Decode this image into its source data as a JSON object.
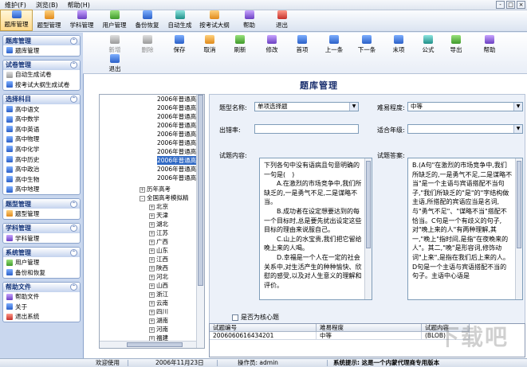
{
  "menubar": {
    "items": [
      "维护(F)",
      "浏览(B)",
      "帮助(H)"
    ]
  },
  "window_controls": [
    "-",
    "□",
    "×"
  ],
  "toolbar": {
    "items": [
      {
        "label": "题库管理",
        "icon": "database-icon"
      },
      {
        "label": "题型管理",
        "icon": "list-icon"
      },
      {
        "label": "学科管理",
        "icon": "book-icon"
      },
      {
        "label": "用户管理",
        "icon": "users-icon"
      },
      {
        "label": "备份恢复",
        "icon": "save-icon"
      },
      {
        "label": "自动生成",
        "icon": "generate-icon"
      },
      {
        "label": "按考试大纲",
        "icon": "outline-icon"
      },
      {
        "label": "帮助",
        "icon": "help-icon"
      },
      {
        "label": "退出",
        "icon": "exit-icon"
      }
    ]
  },
  "sidebar": {
    "panels": [
      {
        "title": "题库管理",
        "items": [
          "题库管理"
        ]
      },
      {
        "title": "试卷管理",
        "items": [
          "自动生成试卷",
          "按考试大纲生成试卷"
        ]
      },
      {
        "title": "选择科目",
        "items": [
          "高中语文",
          "高中数学",
          "高中英语",
          "高中物理",
          "高中化学",
          "高中历史",
          "高中政治",
          "高中生物",
          "高中地理"
        ]
      },
      {
        "title": "题型管理",
        "items": [
          "题型管理"
        ]
      },
      {
        "title": "学科管理",
        "items": [
          "学科管理"
        ]
      },
      {
        "title": "系统管理",
        "items": [
          "用户管理",
          "备份和恢复"
        ]
      },
      {
        "title": "帮助文件",
        "items": [
          "帮助文件",
          "关于",
          "退出系统"
        ]
      }
    ]
  },
  "subtoolbar": {
    "items": [
      "新增",
      "删除",
      "保存",
      "取消",
      "刷新",
      "修改",
      "首项",
      "上一条",
      "下一条",
      "末项",
      "公式",
      "导出",
      "帮助",
      "退出"
    ]
  },
  "page_title": "题库管理",
  "tree": {
    "items": [
      "2006年普通高",
      "2006年普通高",
      "2006年普通高",
      "2006年普通高",
      "2006年普通高",
      "2006年普通高",
      "2006年普通高",
      "2006年普通高",
      "2006年普通高",
      "2006年普通高"
    ],
    "selected_index": 7,
    "groups": [
      "历年高考",
      "全国高考模拟精"
    ],
    "regions": [
      "北京",
      "天津",
      "湖北",
      "江苏",
      "广西",
      "山东",
      "江西",
      "陕西",
      "河北",
      "山西",
      "浙江",
      "云南",
      "四川",
      "湖南",
      "河南",
      "福建",
      "广东",
      "上海"
    ]
  },
  "form": {
    "type_label": "题型名称:",
    "type_value": "单项选择题",
    "difficulty_label": "难易程度:",
    "difficulty_value": "中等",
    "setter_label": "出错率:",
    "setter_value": "",
    "grade_label": "适合年级:",
    "grade_value": "",
    "content_label": "试题内容:",
    "answer_label": "试题答案:",
    "content_text": "下列各句中没有语病且句意明确的一句是(　)\n　　A.在激烈的市场竞争中,我们所缺乏的,一是勇气不足,二是谋略不当。\n　　B.成功者在设定想要达到的每一个目标时,总是要先扰出设定这些目标的理由来说服自己。\n　　C.山上的水宝贵,我们把它留给晚上来的人喝。\n　　D.幸福是一个人在一定的社会关系中,对生活产生的种种愉快、欣慰的感受,以及对人生意义的理解和评价。",
    "answer_text": "B.(A句\"在激烈的市场竞争中,我们所缺乏的,一是勇气不足,二是谋略不当\"是一个主语与宾语搭配不当句子,\"我们所缺乏的\"是\"的\"字结构做主语,所搭配的宾语应当是名词,与\"勇气不足\"、\"谋略不当\"搭配不恰当。C句是一个有歧义的句子,对\"晚上来的人\"有两种理解,其一,\"晚上\"指时间,是指\"在夜晚来的人\"。其二,\"晚\"是形容词,修饰动词\"上来\",是指在我们后上来的人。D句是一个主语与宾语搭配不当的句子。主语中心语是",
    "core_label": "是否为核心题"
  },
  "grid": {
    "headers": [
      "试题编号",
      "难易程度",
      "试题内容"
    ],
    "row": [
      "2006060616434201",
      "中等",
      "(BLOB)"
    ]
  },
  "statusbar": {
    "welcome": "欢迎使用",
    "date": "2006年11月23日",
    "operator": "操作员: admin",
    "tip": "系统提示: 这是一个内蒙代理商专用版本"
  }
}
